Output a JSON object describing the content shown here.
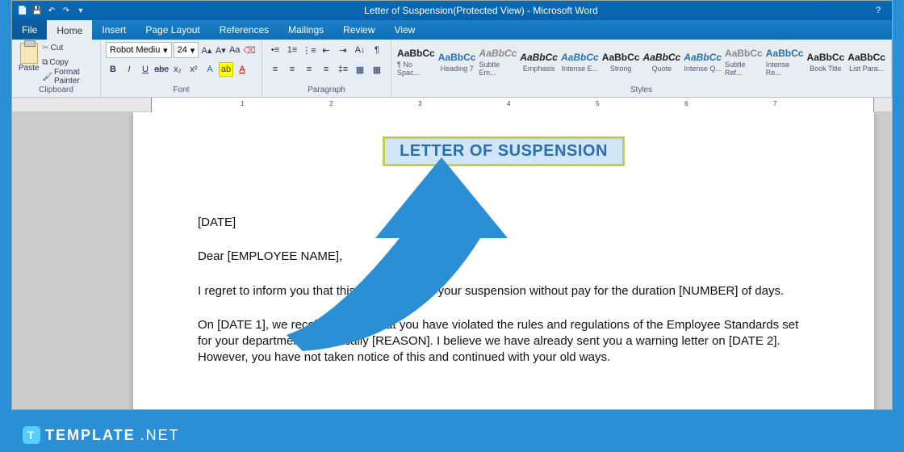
{
  "titlebar": {
    "title": "Letter of Suspension(Protected View) - Microsoft Word"
  },
  "tabs": {
    "file": "File",
    "home": "Home",
    "insert": "Insert",
    "page_layout": "Page Layout",
    "references": "References",
    "mailings": "Mailings",
    "review": "Review",
    "view": "View"
  },
  "clipboard": {
    "paste": "Paste",
    "cut": "Cut",
    "copy": "Copy",
    "format_painter": "Format Painter",
    "label": "Clipboard"
  },
  "font": {
    "name": "Robot Mediu",
    "size": "24",
    "label": "Font"
  },
  "paragraph": {
    "label": "Paragraph"
  },
  "styles": {
    "label": "Styles",
    "items": [
      {
        "prev": "AaBbCc",
        "name": "¶ No Spac...",
        "cls": ""
      },
      {
        "prev": "AaBbCc",
        "name": "Heading 7",
        "cls": "blue"
      },
      {
        "prev": "AaBbCc",
        "name": "Subtle Em...",
        "cls": "light em"
      },
      {
        "prev": "AaBbCc",
        "name": "Emphasis",
        "cls": "em"
      },
      {
        "prev": "AaBbCc",
        "name": "Intense E...",
        "cls": "ital"
      },
      {
        "prev": "AaBbCc",
        "name": "Strong",
        "cls": ""
      },
      {
        "prev": "AaBbCc",
        "name": "Quote",
        "cls": "em"
      },
      {
        "prev": "AaBbCc",
        "name": "Intense Q...",
        "cls": "ital"
      },
      {
        "prev": "AaBbCc",
        "name": "Subtle Ref...",
        "cls": "light"
      },
      {
        "prev": "AaBbCc",
        "name": "Intense Re...",
        "cls": "blue"
      },
      {
        "prev": "AaBbCc",
        "name": "Book Title",
        "cls": ""
      },
      {
        "prev": "AaBbCc",
        "name": "List Para...",
        "cls": ""
      }
    ]
  },
  "doc": {
    "title": "LETTER OF SUSPENSION",
    "date": "[DATE]",
    "greeting": "Dear [EMPLOYEE NAME],",
    "p1": "I regret to inform you that this letter confirms your suspension without pay for the duration [NUMBER] of days.",
    "p2": "On [DATE 1], we received notice that you have violated the rules and regulations of the Employee Standards set for your department, specifically [REASON]. I believe we have already sent you a warning letter on [DATE 2]. However, you have not taken notice of this and continued with your old ways."
  },
  "brand": {
    "name": "TEMPLATE",
    "suffix": ".NET"
  }
}
